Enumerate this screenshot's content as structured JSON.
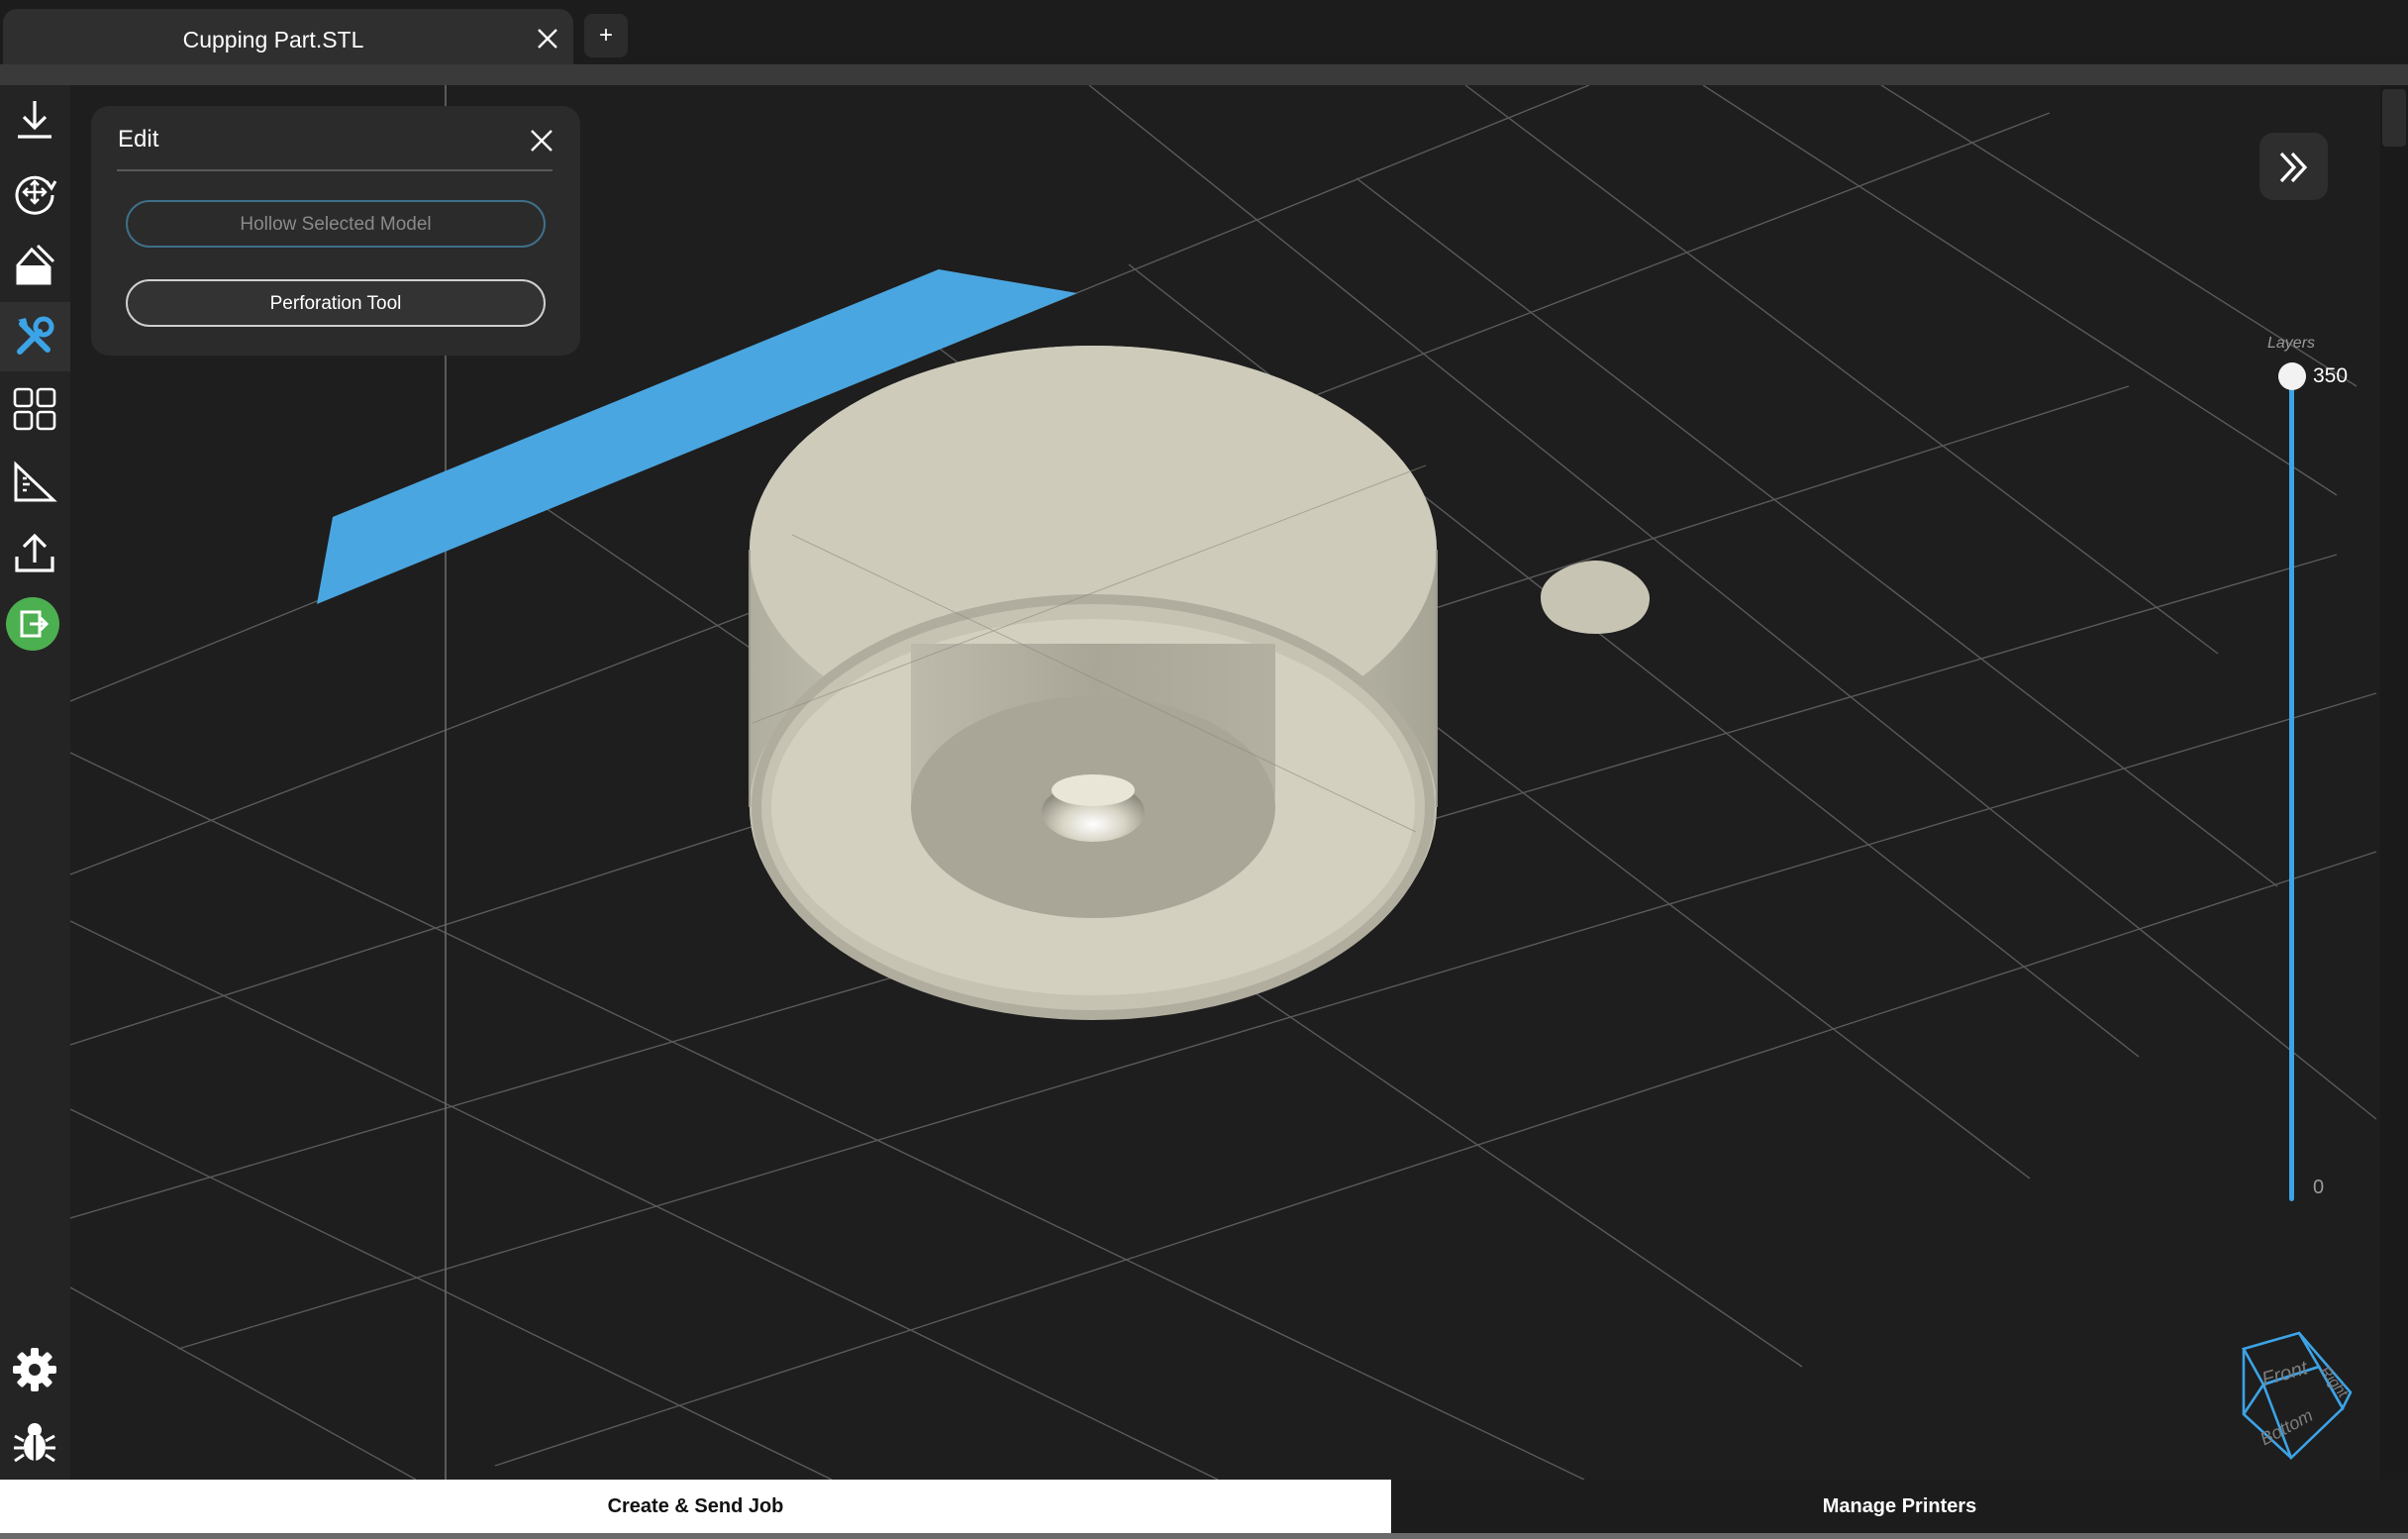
{
  "tabs": [
    {
      "title": "Cupping Part.STL",
      "close_icon": "close-icon"
    }
  ],
  "new_tab_label": "+",
  "sidebar": {
    "tools": [
      {
        "name": "import",
        "icon": "download-icon"
      },
      {
        "name": "transform",
        "icon": "move-rotate-icon"
      },
      {
        "name": "supports",
        "icon": "paint-icon"
      },
      {
        "name": "edit",
        "icon": "wrench-icon",
        "active": true
      },
      {
        "name": "arrange",
        "icon": "grid-icon"
      },
      {
        "name": "measure",
        "icon": "ruler-triangle-icon"
      },
      {
        "name": "export",
        "icon": "upload-icon"
      },
      {
        "name": "exit",
        "icon": "exit-icon"
      }
    ],
    "bottom_tools": [
      {
        "name": "settings",
        "icon": "gear-icon"
      },
      {
        "name": "debug",
        "icon": "bug-icon"
      }
    ]
  },
  "edit_panel": {
    "title": "Edit",
    "hollow_button": "Hollow Selected Model",
    "perforation_button": "Perforation Tool"
  },
  "layers": {
    "label": "Layers",
    "max": "350",
    "min": "0",
    "current_level": 1.0
  },
  "view_cube": {
    "front": "Front",
    "right": "Right",
    "bottom": "Bottom"
  },
  "bottom_bar": {
    "create_job": "Create & Send Job",
    "manage_printers": "Manage Printers"
  },
  "colors": {
    "accent": "#3ca3e6",
    "model": "#c9c6b6",
    "exit_green": "#4caf50",
    "background": "#1e1e1e"
  }
}
